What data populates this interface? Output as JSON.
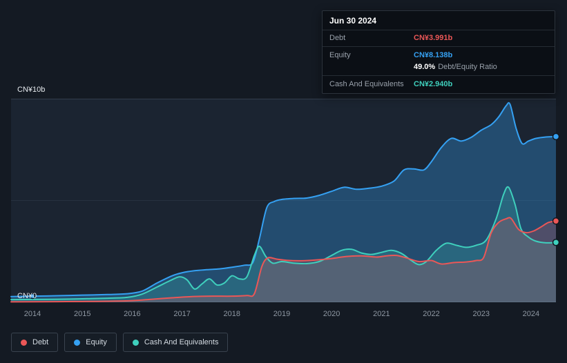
{
  "tooltip": {
    "date": "Jun 30 2024",
    "debt_label": "Debt",
    "debt_value": "CN¥3.991b",
    "equity_label": "Equity",
    "equity_value": "CN¥8.138b",
    "ratio_value": "49.0%",
    "ratio_label": "Debt/Equity Ratio",
    "cash_label": "Cash And Equivalents",
    "cash_value": "CN¥2.940b"
  },
  "axis": {
    "y_top": "CN¥10b",
    "y_bottom": "CN¥0"
  },
  "legend": {
    "items": [
      {
        "label": "Debt",
        "color": "#eb5757"
      },
      {
        "label": "Equity",
        "color": "#35a1f3"
      },
      {
        "label": "Cash And Equivalents",
        "color": "#3fd0bd"
      }
    ]
  },
  "chart_data": {
    "type": "area",
    "currency_unit": "CN¥ billions",
    "x_axis": {
      "range": [
        2013.57,
        2024.5
      ],
      "ticks": [
        2014,
        2015,
        2016,
        2017,
        2018,
        2019,
        2020,
        2021,
        2022,
        2023,
        2024
      ]
    },
    "y_axis": {
      "range": [
        0,
        10
      ],
      "label_top": "CN¥10b",
      "label_bottom": "CN¥0",
      "gridlines": [
        {
          "value": 0,
          "major": true
        },
        {
          "value": 5,
          "major": false
        },
        {
          "value": 10,
          "major": true
        }
      ]
    },
    "legend_position": "bottom-left",
    "series": [
      {
        "key": "equity",
        "name": "Equity",
        "color": "#35a1f3",
        "fill_opacity": 0.32,
        "last_value_label": "CN¥8.138b",
        "extra_markers": [
          [
            2014,
            0.3
          ]
        ],
        "points": [
          [
            2013.57,
            0.28
          ],
          [
            2014,
            0.3
          ],
          [
            2014.5,
            0.32
          ],
          [
            2015,
            0.35
          ],
          [
            2015.5,
            0.38
          ],
          [
            2015.9,
            0.42
          ],
          [
            2016.2,
            0.55
          ],
          [
            2016.5,
            0.95
          ],
          [
            2016.8,
            1.3
          ],
          [
            2017,
            1.45
          ],
          [
            2017.25,
            1.55
          ],
          [
            2017.5,
            1.6
          ],
          [
            2017.75,
            1.64
          ],
          [
            2018,
            1.72
          ],
          [
            2018.25,
            1.82
          ],
          [
            2018.42,
            1.95
          ],
          [
            2018.55,
            3.1
          ],
          [
            2018.7,
            4.65
          ],
          [
            2018.85,
            4.95
          ],
          [
            2019,
            5.05
          ],
          [
            2019.25,
            5.1
          ],
          [
            2019.5,
            5.12
          ],
          [
            2019.75,
            5.25
          ],
          [
            2020,
            5.45
          ],
          [
            2020.25,
            5.65
          ],
          [
            2020.5,
            5.55
          ],
          [
            2020.75,
            5.6
          ],
          [
            2021,
            5.7
          ],
          [
            2021.25,
            5.95
          ],
          [
            2021.45,
            6.5
          ],
          [
            2021.65,
            6.55
          ],
          [
            2021.85,
            6.5
          ],
          [
            2022,
            6.9
          ],
          [
            2022.2,
            7.6
          ],
          [
            2022.4,
            8.05
          ],
          [
            2022.6,
            7.92
          ],
          [
            2022.8,
            8.1
          ],
          [
            2023,
            8.45
          ],
          [
            2023.2,
            8.72
          ],
          [
            2023.35,
            9.1
          ],
          [
            2023.5,
            9.65
          ],
          [
            2023.58,
            9.72
          ],
          [
            2023.7,
            8.55
          ],
          [
            2023.82,
            7.8
          ],
          [
            2023.95,
            7.92
          ],
          [
            2024.1,
            8.05
          ],
          [
            2024.3,
            8.12
          ],
          [
            2024.5,
            8.14
          ]
        ]
      },
      {
        "key": "cash",
        "name": "Cash And Equivalents",
        "color": "#3fd0bd",
        "fill_opacity": 0.2,
        "last_value_label": "CN¥2.940b",
        "points": [
          [
            2013.57,
            0.13
          ],
          [
            2014,
            0.14
          ],
          [
            2014.5,
            0.15
          ],
          [
            2015,
            0.17
          ],
          [
            2015.5,
            0.2
          ],
          [
            2015.9,
            0.24
          ],
          [
            2016.2,
            0.4
          ],
          [
            2016.5,
            0.75
          ],
          [
            2016.75,
            1.05
          ],
          [
            2016.95,
            1.25
          ],
          [
            2017.1,
            1.1
          ],
          [
            2017.25,
            0.65
          ],
          [
            2017.4,
            0.9
          ],
          [
            2017.55,
            1.15
          ],
          [
            2017.7,
            0.85
          ],
          [
            2017.85,
            0.95
          ],
          [
            2018,
            1.3
          ],
          [
            2018.15,
            1.15
          ],
          [
            2018.3,
            1.25
          ],
          [
            2018.45,
            2.3
          ],
          [
            2018.55,
            2.75
          ],
          [
            2018.68,
            2.25
          ],
          [
            2018.82,
            1.92
          ],
          [
            2019,
            2.0
          ],
          [
            2019.25,
            1.92
          ],
          [
            2019.5,
            1.9
          ],
          [
            2019.75,
            2.0
          ],
          [
            2020,
            2.3
          ],
          [
            2020.2,
            2.55
          ],
          [
            2020.4,
            2.6
          ],
          [
            2020.6,
            2.42
          ],
          [
            2020.8,
            2.35
          ],
          [
            2021,
            2.45
          ],
          [
            2021.2,
            2.55
          ],
          [
            2021.4,
            2.4
          ],
          [
            2021.6,
            2.05
          ],
          [
            2021.75,
            1.85
          ],
          [
            2021.9,
            2.0
          ],
          [
            2022.1,
            2.55
          ],
          [
            2022.3,
            2.9
          ],
          [
            2022.5,
            2.8
          ],
          [
            2022.7,
            2.7
          ],
          [
            2022.9,
            2.8
          ],
          [
            2023.1,
            3.05
          ],
          [
            2023.3,
            4.1
          ],
          [
            2023.45,
            5.3
          ],
          [
            2023.55,
            5.65
          ],
          [
            2023.68,
            4.8
          ],
          [
            2023.8,
            3.6
          ],
          [
            2023.95,
            3.2
          ],
          [
            2024.1,
            3.0
          ],
          [
            2024.3,
            2.92
          ],
          [
            2024.5,
            2.94
          ]
        ]
      },
      {
        "key": "debt",
        "name": "Debt",
        "color": "#eb5757",
        "fill_opacity": 0.22,
        "last_value_label": "CN¥3.991b",
        "points": [
          [
            2013.57,
            0.02
          ],
          [
            2014.5,
            0.03
          ],
          [
            2015,
            0.04
          ],
          [
            2015.5,
            0.05
          ],
          [
            2016,
            0.08
          ],
          [
            2016.4,
            0.15
          ],
          [
            2016.8,
            0.22
          ],
          [
            2017.2,
            0.28
          ],
          [
            2017.6,
            0.3
          ],
          [
            2018,
            0.3
          ],
          [
            2018.3,
            0.33
          ],
          [
            2018.45,
            0.42
          ],
          [
            2018.6,
            1.75
          ],
          [
            2018.72,
            2.18
          ],
          [
            2018.9,
            2.12
          ],
          [
            2019.1,
            2.06
          ],
          [
            2019.4,
            2.04
          ],
          [
            2019.7,
            2.08
          ],
          [
            2020,
            2.15
          ],
          [
            2020.3,
            2.25
          ],
          [
            2020.6,
            2.28
          ],
          [
            2020.9,
            2.22
          ],
          [
            2021.1,
            2.28
          ],
          [
            2021.3,
            2.3
          ],
          [
            2021.5,
            2.18
          ],
          [
            2021.75,
            2.0
          ],
          [
            2022,
            2.05
          ],
          [
            2022.2,
            1.88
          ],
          [
            2022.45,
            1.95
          ],
          [
            2022.7,
            1.98
          ],
          [
            2022.9,
            2.05
          ],
          [
            2023.05,
            2.2
          ],
          [
            2023.2,
            3.4
          ],
          [
            2023.35,
            3.92
          ],
          [
            2023.5,
            4.1
          ],
          [
            2023.6,
            4.12
          ],
          [
            2023.75,
            3.58
          ],
          [
            2023.9,
            3.42
          ],
          [
            2024.05,
            3.5
          ],
          [
            2024.2,
            3.7
          ],
          [
            2024.35,
            3.92
          ],
          [
            2024.5,
            3.99
          ]
        ]
      }
    ]
  }
}
